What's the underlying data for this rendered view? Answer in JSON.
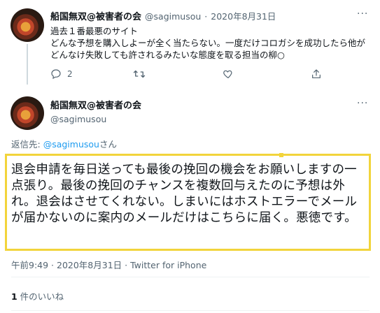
{
  "tweet1": {
    "display_name": "船国無双@被害者の会",
    "handle": "@sagimusou",
    "sep": "·",
    "date": "2020年8月31日",
    "more_label": "···",
    "line1": "過去１番最悪のサイト",
    "line2": "どんな予想を購入しよーが全く当たらない。一度だけコロガシを成功したら他がどんなけ失敗しても許されるみたいな態度を取る担当の柳○",
    "reply_count": "2"
  },
  "tweet2": {
    "display_name": "船国無双@被害者の会",
    "handle": "@sagimusou",
    "more_label": "···",
    "reply_prefix": "返信先: ",
    "reply_handle": "@sagimusou",
    "reply_suffix": "さん",
    "body": "退会申請を毎日送っても最後の挽回の機会をお願いしますの一点張り。最後の挽回のチャンスを複数回与えたのに予想は外れ。退会はさせてくれない。しまいにはホストエラーでメールが届かないのに案内のメールだけはこちらに届く。悪徳です。",
    "timestamp": "午前9:49 · 2020年8月31日 · Twitter for iPhone",
    "likes_count": "1",
    "likes_label": " 件のいいね"
  }
}
